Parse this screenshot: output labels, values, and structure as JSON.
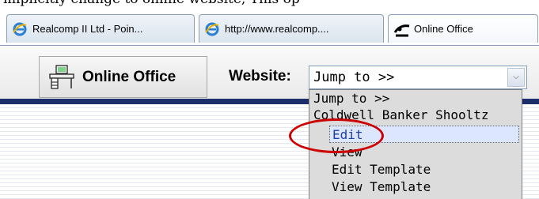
{
  "top_caption": "implicitly change to online website, This op",
  "tabs": [
    {
      "label": "Realcomp II Ltd - Poin...",
      "icon": "ie-icon",
      "active": false
    },
    {
      "label": "http://www.realcomp....",
      "icon": "ie-icon",
      "active": false
    },
    {
      "label": "Online Office",
      "icon": "online-office-logo-icon",
      "active": true
    }
  ],
  "toolbar": {
    "online_office_label": "Online Office",
    "website_label": "Website:",
    "select_value": "Jump to >>"
  },
  "dropdown": {
    "items": [
      {
        "label": "Jump to >>"
      },
      {
        "label": "Coldwell Banker Shooltz"
      },
      {
        "label": "Edit",
        "selected": true
      },
      {
        "label": "View"
      },
      {
        "label": "Edit Template"
      },
      {
        "label": "View Template"
      }
    ]
  },
  "colors": {
    "accent_bar": "#1c2f6b",
    "highlight_ellipse": "#cc0000",
    "selected_text": "#1f3ea8"
  }
}
